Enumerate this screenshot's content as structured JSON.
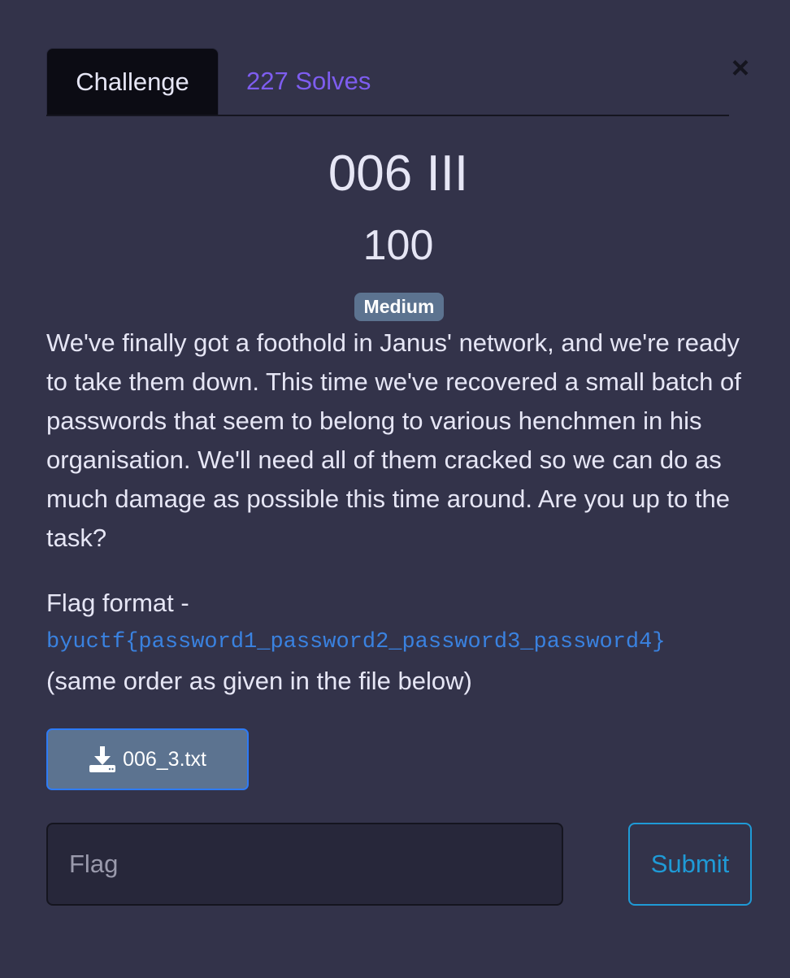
{
  "modal": {
    "close_glyph": "×"
  },
  "tabs": [
    {
      "label": "Challenge",
      "active": true
    },
    {
      "label": "227 Solves",
      "active": false
    }
  ],
  "challenge": {
    "name": "006 III",
    "points": "100",
    "difficulty": "Medium",
    "description": "We've finally got a foothold in Janus' network, and we're ready to take them down. This time we've recovered a small batch of passwords that seem to belong to various henchmen in his organisation. We'll need all of them cracked so we can do as much damage as possible this time around. Are you up to the task?",
    "flag_format_label": "Flag format -",
    "flag_format_code": "byuctf{password1_password2_password3_password4}",
    "flag_format_note": "(same order as given in the file below)"
  },
  "file": {
    "name": "006_3.txt",
    "icon": "download-icon"
  },
  "submission": {
    "placeholder": "Flag",
    "value": "",
    "submit_label": "Submit"
  },
  "colors": {
    "background": "#33334a",
    "tab_active_bg": "#0c0c14",
    "solves_link": "#7e5df0",
    "badge": "#5c7390",
    "code": "#3a82e0",
    "submit": "#1f9ad6"
  }
}
